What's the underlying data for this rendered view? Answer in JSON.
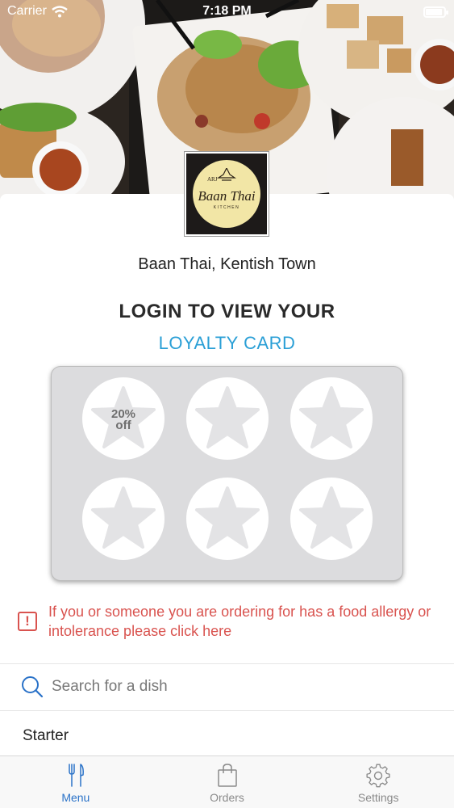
{
  "status_bar": {
    "carrier": "Carrier",
    "time": "7:18 PM"
  },
  "restaurant": {
    "name": "Baan Thai, Kentish Town",
    "logo": {
      "prefix": "ARJ",
      "main": "Baan Thai",
      "sub": "KITCHEN"
    }
  },
  "loyalty": {
    "title": "LOGIN TO VIEW YOUR",
    "subtitle": "LOYALTY CARD",
    "stamps": [
      {
        "label_top": "20%",
        "label_bottom": "off"
      },
      {
        "label_top": "",
        "label_bottom": ""
      },
      {
        "label_top": "",
        "label_bottom": ""
      },
      {
        "label_top": "",
        "label_bottom": ""
      },
      {
        "label_top": "",
        "label_bottom": ""
      },
      {
        "label_top": "",
        "label_bottom": ""
      }
    ]
  },
  "allergy": {
    "text": "If you or someone you are ordering for has a food allergy or intolerance please click here",
    "icon": "!"
  },
  "search": {
    "placeholder": "Search for a dish",
    "value": ""
  },
  "menu": {
    "first_category": "Starter"
  },
  "tabs": [
    {
      "label": "Menu",
      "icon": "fork-knife-icon",
      "active": true
    },
    {
      "label": "Orders",
      "icon": "shopping-bag-icon",
      "active": false
    },
    {
      "label": "Settings",
      "icon": "gear-icon",
      "active": false
    }
  ],
  "colors": {
    "accent": "#2a9fd6",
    "tab_active": "#2a72c8",
    "alert": "#d9534f",
    "card": "#dcdcde"
  }
}
